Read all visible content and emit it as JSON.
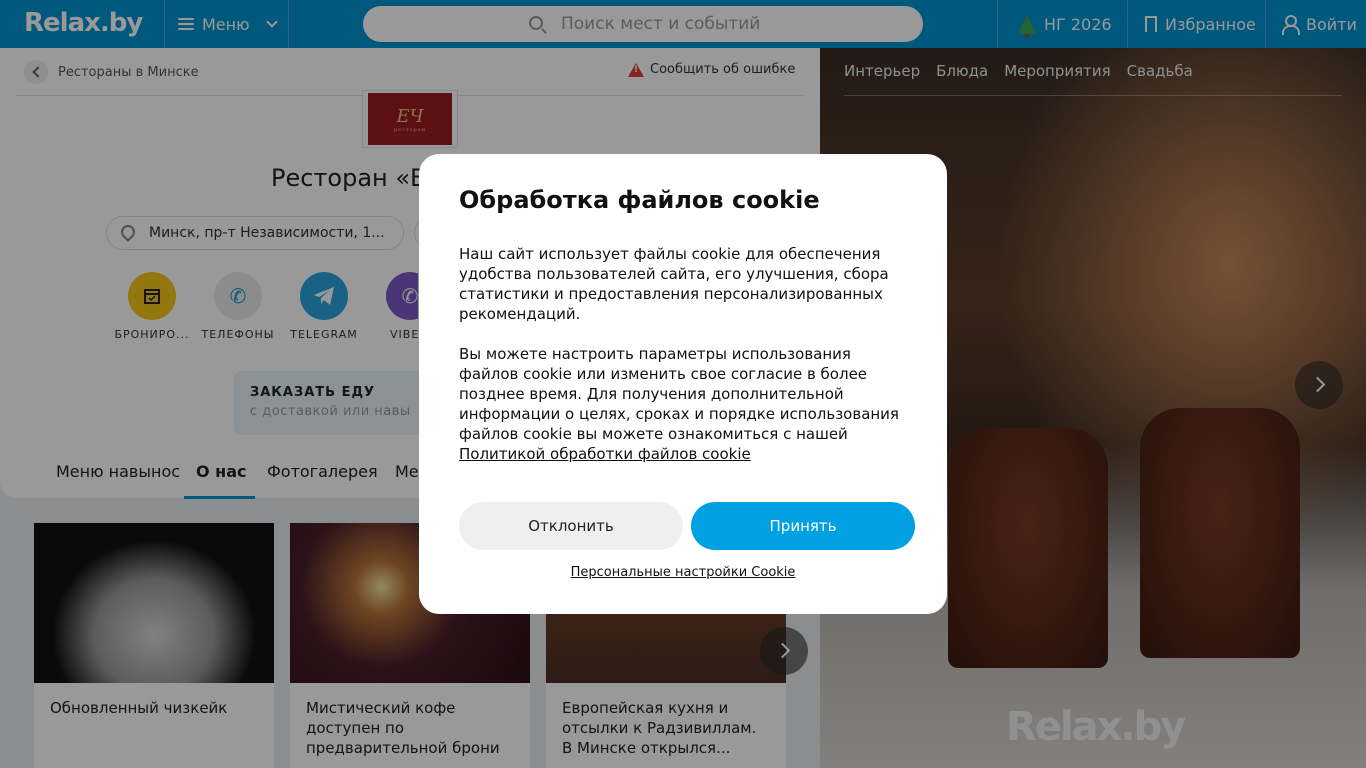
{
  "header": {
    "logo": "Relax.by",
    "menu_label": "Меню",
    "search_placeholder": "Поиск мест и событий",
    "ny_label": "НГ 2026",
    "favorites_label": "Избранное",
    "login_label": "Войти"
  },
  "breadcrumb": {
    "label": "Рестораны в Минске",
    "report_label": "Сообщить об ошибке"
  },
  "venue": {
    "logo_text": "ресторан",
    "title": "Ресторан «Е",
    "address": "Минск, пр-т Независимости, 1..."
  },
  "actions": [
    {
      "label": "БРОНИРО...",
      "color": "#f5c518",
      "icon": "calendar-icon"
    },
    {
      "label": "ТЕЛЕФОНЫ",
      "color": "#e9e9e9",
      "icon": "phone-icon"
    },
    {
      "label": "TELEGRAM",
      "color": "#2aa3df",
      "icon": "telegram-icon"
    },
    {
      "label": "VIBE",
      "color": "#7d55c7",
      "icon": "viber-icon"
    }
  ],
  "order": {
    "title": "ЗАКАЗАТЬ ЕДУ",
    "subtitle": "с доставкой или навы"
  },
  "tabs": [
    "Меню навынос",
    "О нас",
    "Фотогалерея",
    "Ме"
  ],
  "active_tab": "О нас",
  "cards": [
    {
      "text": "Обновленный чизкейк"
    },
    {
      "text": "Мистический кофе доступен по предварительной брони"
    },
    {
      "text": "Европейская кухня и отсылки к Радзивиллам. В Минске открылся..."
    }
  ],
  "photo": {
    "tabs": [
      "Интерьер",
      "Блюда",
      "Мероприятия",
      "Свадьба"
    ],
    "watermark": "Relax.by"
  },
  "cookie": {
    "title": "Обработка файлов cookie",
    "para1": "Наш сайт использует файлы cookie для обеспечения удобства пользователей сайта, его улучшения, сбора статистики и предоставления персонализированных рекомендаций.",
    "para2": "Вы можете настроить параметры использования файлов cookie или изменить свое согласие в более позднее время. Для получения дополнительной информации о целях, сроках и порядке использования файлов cookie вы можете ознакомиться с нашей",
    "policy_link": "Политикой обработки файлов cookie",
    "decline_label": "Отклонить",
    "accept_label": "Принять",
    "settings_link": "Персональные настройки Cookie"
  },
  "colors": {
    "brand": "#0093d0",
    "accept": "#00a0e3"
  }
}
